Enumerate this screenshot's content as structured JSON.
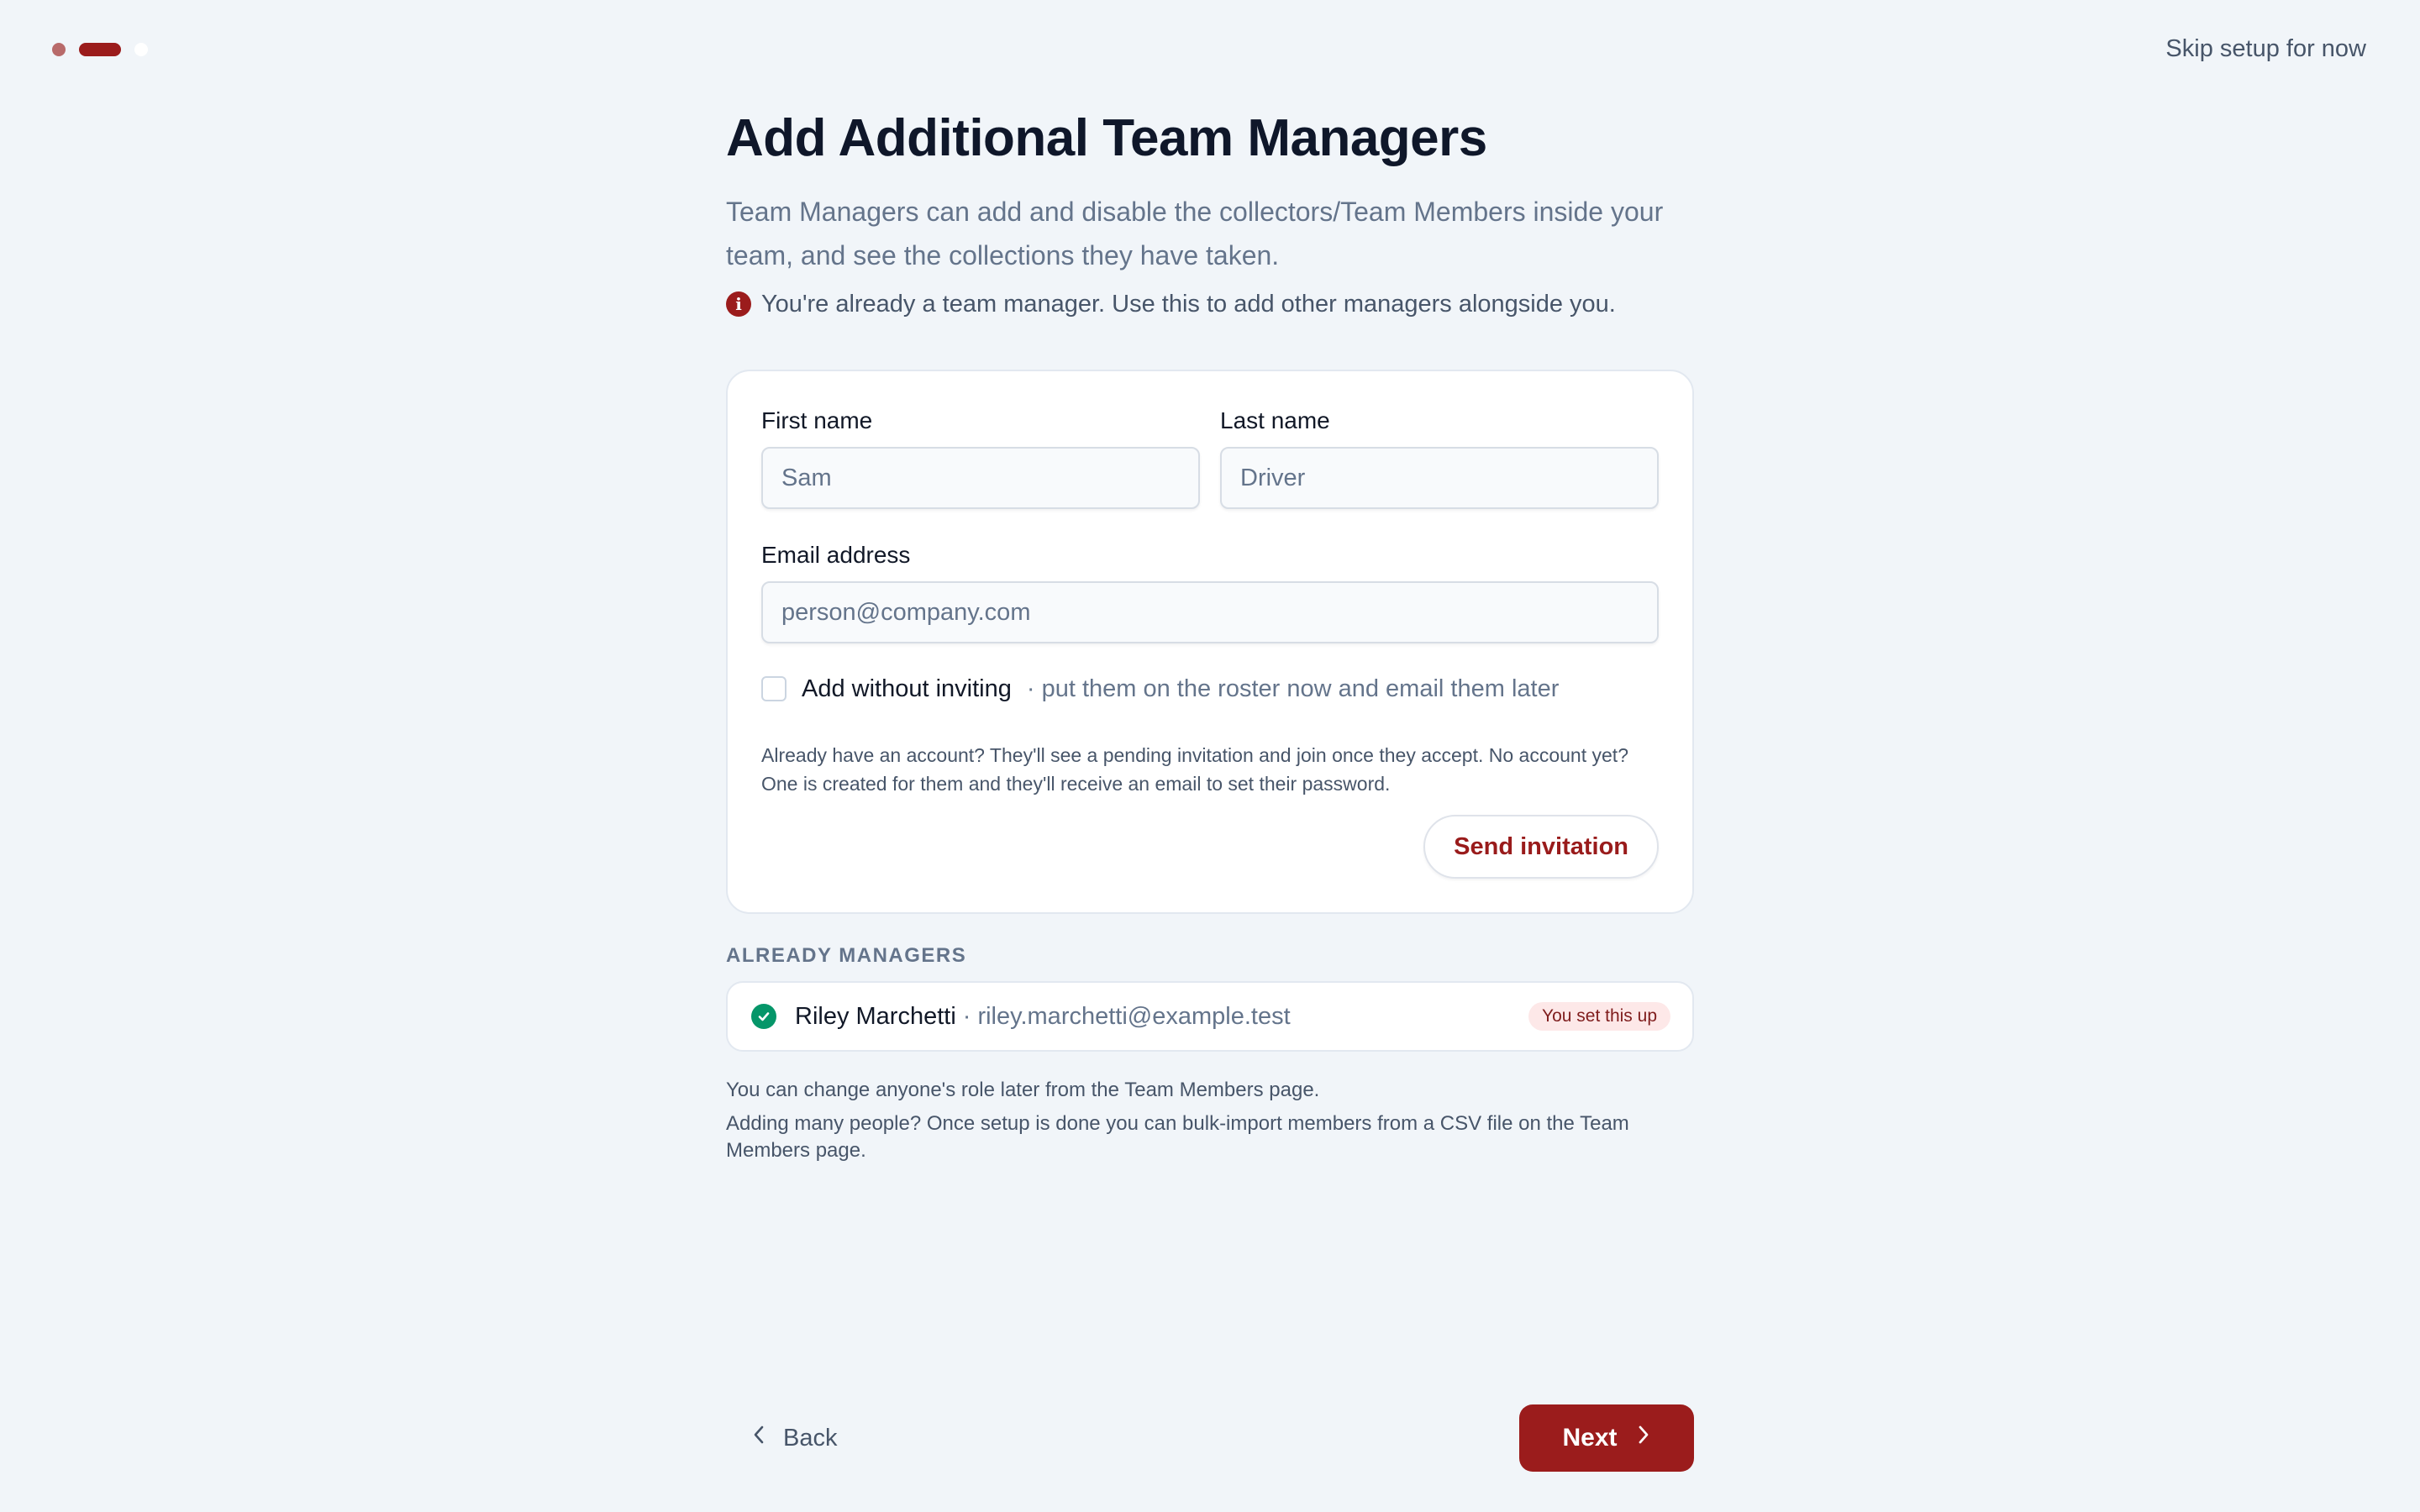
{
  "header": {
    "skip_label": "Skip setup for now",
    "steps": [
      {
        "state": "complete"
      },
      {
        "state": "current"
      },
      {
        "state": "pending"
      }
    ]
  },
  "intro": {
    "title": "Add Additional Team Managers",
    "description": "Team Managers can add and disable the collectors/Team Members inside your team, and see the collections they have taken.",
    "info_note": "You're already a team manager. Use this to add other managers alongside you.",
    "info_icon": "info-icon"
  },
  "form": {
    "first_name": {
      "label": "First name",
      "placeholder": "Sam",
      "value": ""
    },
    "last_name": {
      "label": "Last name",
      "placeholder": "Driver",
      "value": ""
    },
    "email": {
      "label": "Email address",
      "placeholder": "person@company.com",
      "value": ""
    },
    "add_without_inviting": {
      "label": "Add without inviting",
      "hint": "· put them on the roster now and email them later",
      "checked": false
    },
    "help_text": "Already have an account? They'll see a pending invitation and join once they accept. No account yet? One is created for them and they'll receive an email to set their password.",
    "send_label": "Send invitation"
  },
  "managers": {
    "heading": "ALREADY MANAGERS",
    "items": [
      {
        "name": "Riley Marchetti",
        "separator": "·",
        "email": "riley.marchetti@example.test",
        "badge": "You set this up",
        "icon": "check-circle-icon"
      }
    ]
  },
  "notes": {
    "role_note": "You can change anyone's role later from the Team Members page.",
    "bulk_note": "Adding many people? Once setup is done you can bulk-import members from a CSV file on the Team Members page."
  },
  "nav": {
    "back_label": "Back",
    "next_label": "Next"
  },
  "colors": {
    "accent": "#9b1c1c",
    "success": "#059669",
    "background": "#f1f5f9"
  }
}
